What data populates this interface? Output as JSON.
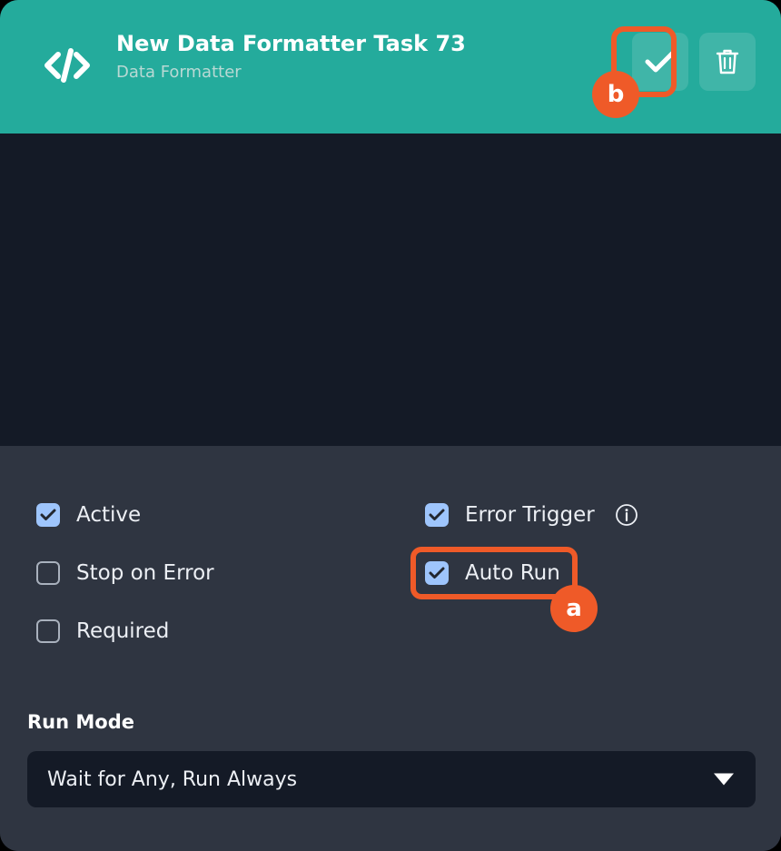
{
  "header": {
    "icon": "code-icon",
    "title": "New Data Formatter Task 73",
    "subtitle": "Data Formatter",
    "accent_color": "#24ab9c",
    "actions": [
      {
        "name": "confirm-button",
        "icon": "check-icon",
        "label": "Confirm"
      },
      {
        "name": "delete-button",
        "icon": "trash-icon",
        "label": "Delete"
      }
    ]
  },
  "editor": {
    "background_color": "#141a26",
    "content": ""
  },
  "options": {
    "background_color": "#2f3541",
    "checkbox_color": "#9ec5fc",
    "left_column": [
      {
        "label": "Active",
        "checked": true
      },
      {
        "label": "Stop on Error",
        "checked": false
      },
      {
        "label": "Required",
        "checked": false
      }
    ],
    "right_column": [
      {
        "label": "Error Trigger",
        "checked": true,
        "info_icon": "info-icon"
      },
      {
        "label": "Auto Run",
        "checked": true
      }
    ]
  },
  "run_mode": {
    "label": "Run Mode",
    "selected": "Wait for Any, Run Always",
    "arrow_icon": "chevron-down-icon"
  },
  "annotations": {
    "color": "#ef5a28",
    "markers": [
      {
        "id": "a",
        "target": "Auto Run"
      },
      {
        "id": "b",
        "target": "Confirm"
      }
    ]
  }
}
